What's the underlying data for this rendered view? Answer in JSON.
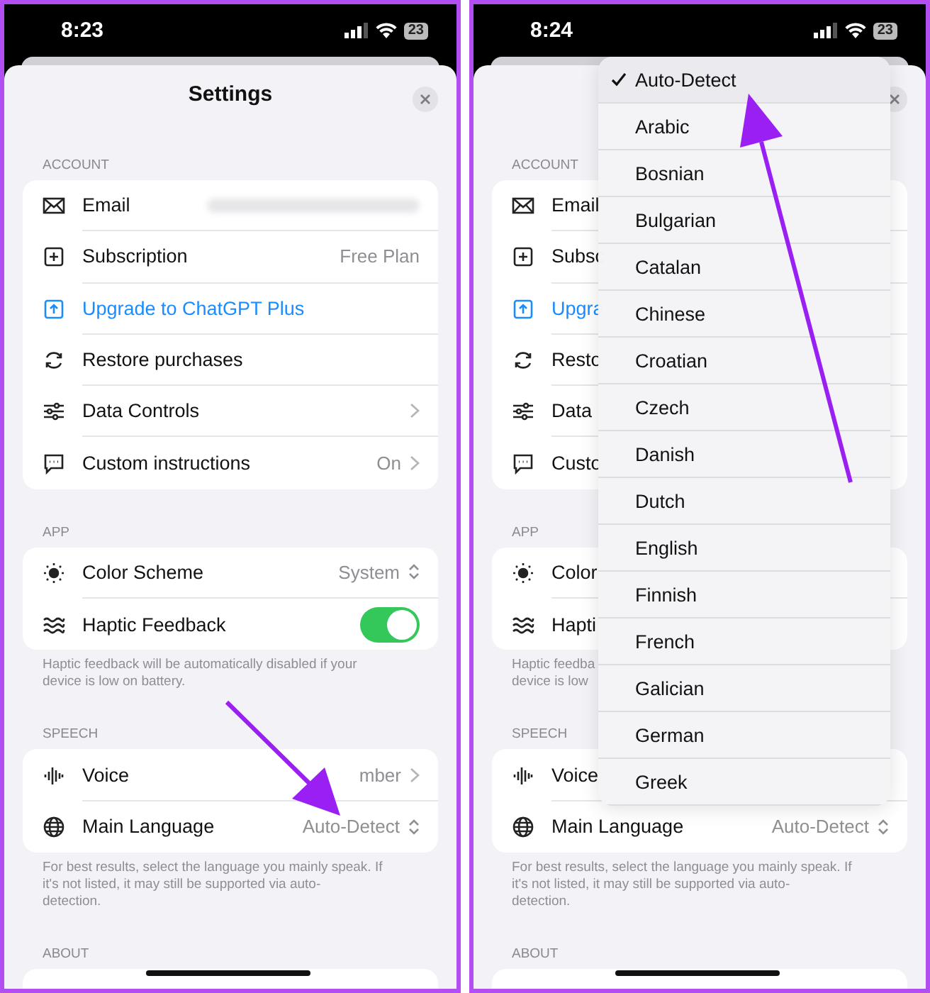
{
  "screens": [
    {
      "status_time": "8:23",
      "battery": "23",
      "title": "Settings",
      "sections": [
        {
          "header": "ACCOUNT",
          "rows": [
            {
              "kind": "redacted",
              "label": "Email"
            },
            {
              "kind": "plain",
              "label": "Subscription",
              "value": "Free Plan"
            },
            {
              "kind": "link",
              "label": "Upgrade to ChatGPT Plus"
            },
            {
              "kind": "plain",
              "label": "Restore purchases"
            },
            {
              "kind": "nav",
              "label": "Data Controls"
            },
            {
              "kind": "nav",
              "label": "Custom instructions",
              "value": "On"
            }
          ]
        },
        {
          "header": "APP",
          "rows": [
            {
              "kind": "picker",
              "label": "Color Scheme",
              "value": "System"
            },
            {
              "kind": "toggle",
              "label": "Haptic Feedback",
              "on": true
            }
          ],
          "footnote": [
            "Haptic feedback will be automatically disabled if your",
            "device is low on battery."
          ]
        },
        {
          "header": "SPEECH",
          "rows": [
            {
              "kind": "nav",
              "label": "Voice",
              "value": "mber"
            },
            {
              "kind": "picker",
              "label": "Main Language",
              "value": "Auto-Detect"
            }
          ],
          "footnote": [
            "For best results, select the language you mainly speak. If",
            "it's not listed, it may still be supported via auto-",
            "detection."
          ]
        },
        {
          "header": "ABOUT"
        }
      ]
    },
    {
      "status_time": "8:24",
      "battery": "23",
      "sections": [
        {
          "header": "ACCOUNT",
          "rows": [
            {
              "kind": "plain",
              "label": "Email"
            },
            {
              "kind": "plain",
              "label": "Subsc"
            },
            {
              "kind": "link",
              "label": "Upgra"
            },
            {
              "kind": "plain",
              "label": "Resto"
            },
            {
              "kind": "plain",
              "label": "Data"
            },
            {
              "kind": "plain",
              "label": "Custo"
            }
          ]
        },
        {
          "header": "APP",
          "rows": [
            {
              "kind": "plain",
              "label": "Color"
            },
            {
              "kind": "plain",
              "label": "Hapti"
            }
          ],
          "footnote": [
            "Haptic feedba",
            "device is low"
          ]
        },
        {
          "header": "SPEECH",
          "rows": [
            {
              "kind": "plain",
              "label": "Voice"
            },
            {
              "kind": "picker",
              "label": "Main Language",
              "value": "Auto-Detect"
            }
          ],
          "footnote": [
            "For best results, select the language you mainly speak. If",
            "it's not listed, it may still be supported via auto-",
            "detection."
          ]
        },
        {
          "header": "ABOUT"
        }
      ],
      "menu": [
        {
          "label": "Auto-Detect",
          "selected": true
        },
        {
          "label": "Arabic",
          "selected": false
        },
        {
          "label": "Bosnian",
          "selected": false
        },
        {
          "label": "Bulgarian",
          "selected": false
        },
        {
          "label": "Catalan",
          "selected": false
        },
        {
          "label": "Chinese",
          "selected": false
        },
        {
          "label": "Croatian",
          "selected": false
        },
        {
          "label": "Czech",
          "selected": false
        },
        {
          "label": "Danish",
          "selected": false
        },
        {
          "label": "Dutch",
          "selected": false
        },
        {
          "label": "English",
          "selected": false
        },
        {
          "label": "Finnish",
          "selected": false
        },
        {
          "label": "French",
          "selected": false
        },
        {
          "label": "Galician",
          "selected": false
        },
        {
          "label": "German",
          "selected": false
        },
        {
          "label": "Greek",
          "selected": false
        }
      ]
    }
  ]
}
